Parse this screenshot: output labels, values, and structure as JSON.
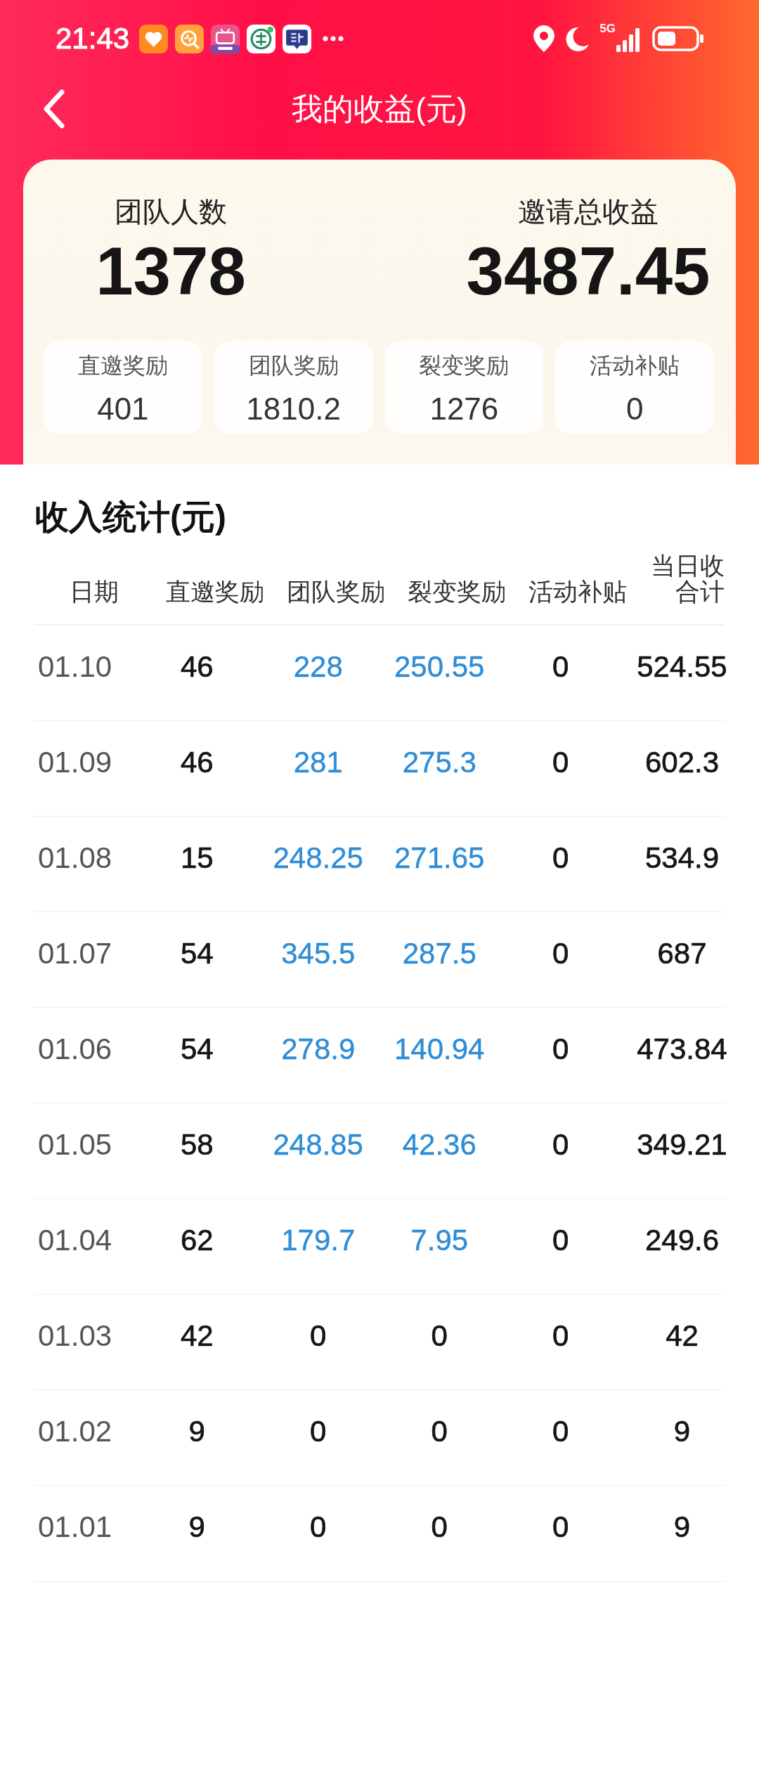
{
  "status_bar": {
    "time": "21:43",
    "network": "5G"
  },
  "nav": {
    "title": "我的收益(元)"
  },
  "summary": {
    "stats": [
      {
        "label": "团队人数",
        "value": "1378"
      },
      {
        "label": "邀请总收益",
        "value": "3487.45"
      }
    ],
    "tiles": [
      {
        "label": "直邀奖励",
        "value": "401"
      },
      {
        "label": "团队奖励",
        "value": "1810.2"
      },
      {
        "label": "裂变奖励",
        "value": "1276"
      },
      {
        "label": "活动补贴",
        "value": "0"
      }
    ]
  },
  "income": {
    "title": "收入统计(元)",
    "columns": [
      "日期",
      "直邀奖励",
      "团队奖励",
      "裂变奖励",
      "活动补贴",
      "当日收合计"
    ],
    "rows": [
      {
        "date": "01.10",
        "direct_reward": "46",
        "team_reward": {
          "value": "228",
          "link": true
        },
        "fission_reward": {
          "value": "250.55",
          "link": true
        },
        "activity_subsidy": "0",
        "daily_total": "524.55"
      },
      {
        "date": "01.09",
        "direct_reward": "46",
        "team_reward": {
          "value": "281",
          "link": true
        },
        "fission_reward": {
          "value": "275.3",
          "link": true
        },
        "activity_subsidy": "0",
        "daily_total": "602.3"
      },
      {
        "date": "01.08",
        "direct_reward": "15",
        "team_reward": {
          "value": "248.25",
          "link": true
        },
        "fission_reward": {
          "value": "271.65",
          "link": true
        },
        "activity_subsidy": "0",
        "daily_total": "534.9"
      },
      {
        "date": "01.07",
        "direct_reward": "54",
        "team_reward": {
          "value": "345.5",
          "link": true
        },
        "fission_reward": {
          "value": "287.5",
          "link": true
        },
        "activity_subsidy": "0",
        "daily_total": "687"
      },
      {
        "date": "01.06",
        "direct_reward": "54",
        "team_reward": {
          "value": "278.9",
          "link": true
        },
        "fission_reward": {
          "value": "140.94",
          "link": true
        },
        "activity_subsidy": "0",
        "daily_total": "473.84"
      },
      {
        "date": "01.05",
        "direct_reward": "58",
        "team_reward": {
          "value": "248.85",
          "link": true
        },
        "fission_reward": {
          "value": "42.36",
          "link": true
        },
        "activity_subsidy": "0",
        "daily_total": "349.21"
      },
      {
        "date": "01.04",
        "direct_reward": "62",
        "team_reward": {
          "value": "179.7",
          "link": true
        },
        "fission_reward": {
          "value": "7.95",
          "link": true
        },
        "activity_subsidy": "0",
        "daily_total": "249.6"
      },
      {
        "date": "01.03",
        "direct_reward": "42",
        "team_reward": {
          "value": "0",
          "link": false
        },
        "fission_reward": {
          "value": "0",
          "link": false
        },
        "activity_subsidy": "0",
        "daily_total": "42"
      },
      {
        "date": "01.02",
        "direct_reward": "9",
        "team_reward": {
          "value": "0",
          "link": false
        },
        "fission_reward": {
          "value": "0",
          "link": false
        },
        "activity_subsidy": "0",
        "daily_total": "9"
      },
      {
        "date": "01.01",
        "direct_reward": "9",
        "team_reward": {
          "value": "0",
          "link": false
        },
        "fission_reward": {
          "value": "0",
          "link": false
        },
        "activity_subsidy": "0",
        "daily_total": "9"
      }
    ]
  }
}
